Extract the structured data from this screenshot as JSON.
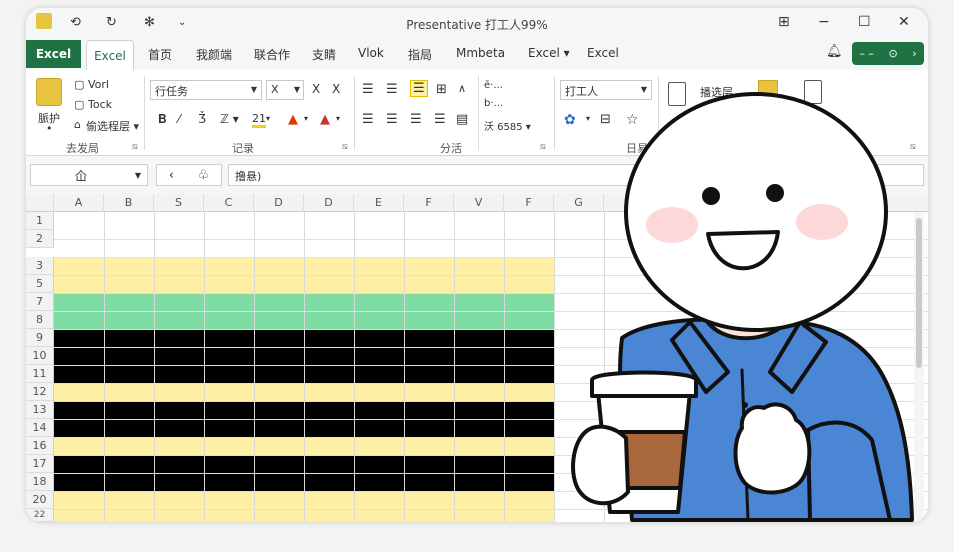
{
  "window": {
    "title": "Presentative  打工人99%"
  },
  "quick_access": {
    "tooltip": ""
  },
  "tabs": {
    "file": "Excel",
    "active": "Excel",
    "items": [
      "首页",
      "我颜端",
      "联合作",
      "支睛",
      "Vlok",
      "指局",
      "Mmbeta",
      "Excel ▾",
      "Excel"
    ]
  },
  "ribbon": {
    "paste_label": "脈护",
    "paste_sub": "•",
    "vord": "Vorl",
    "tock": "Tock",
    "format_label": "偷选程层 ▾",
    "group1": "去发局",
    "font_name": "行任务",
    "font_size": "X",
    "group2": "记录",
    "group3": "分活",
    "align_a": "ē·...",
    "align_b": "b·...",
    "align_c": "沃 6585 ▾",
    "style_dd": "打工人",
    "group4": "日易",
    "tpl_label": "播选层"
  },
  "formula_bar": {
    "name_box": "仚",
    "formula": "撸悬)"
  },
  "columns": [
    "A",
    "B",
    "S",
    "C",
    "D",
    "D",
    "E",
    "F",
    "V",
    "F",
    "G"
  ],
  "rows": [
    "1",
    "2",
    "3",
    "5",
    "7",
    "8",
    "9",
    "10",
    "11",
    "12",
    "13",
    "14",
    "16",
    "17",
    "18",
    "20",
    "22"
  ],
  "colors": {
    "brand": "#207245",
    "yellow": "#fdf0a6",
    "green": "#7fdca5",
    "black": "#000000",
    "shirt": "#4a86d4"
  },
  "icons": [
    "paste-icon",
    "copy-icon",
    "cut-icon",
    "format-painter-icon",
    "bold-icon",
    "italic-icon",
    "underline-icon",
    "fill-color-icon",
    "font-color-icon",
    "align-icon",
    "wrap-icon",
    "merge-icon",
    "style-icon",
    "star-icon",
    "template-icon",
    "bell-icon"
  ]
}
